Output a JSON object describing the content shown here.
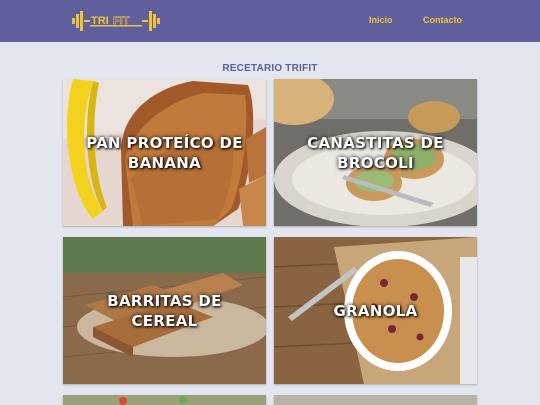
{
  "header": {
    "logo_text": "TRIFIT",
    "nav": [
      {
        "label": "Inicio"
      },
      {
        "label": "Contacto"
      }
    ]
  },
  "main": {
    "title": "RECETARIO TRIFIT",
    "recipes": [
      {
        "title": "PAN PROTEÍCO DE BANANA"
      },
      {
        "title": "CANASTITAS DE BROCOLI"
      },
      {
        "title": "BARRITAS DE CEREAL"
      },
      {
        "title": "GRANOLA"
      }
    ]
  },
  "colors": {
    "header_bg": "#5e5f9c",
    "accent": "#f0c23a",
    "page_bg": "#e3e6ef",
    "title": "#5e5f9c"
  }
}
